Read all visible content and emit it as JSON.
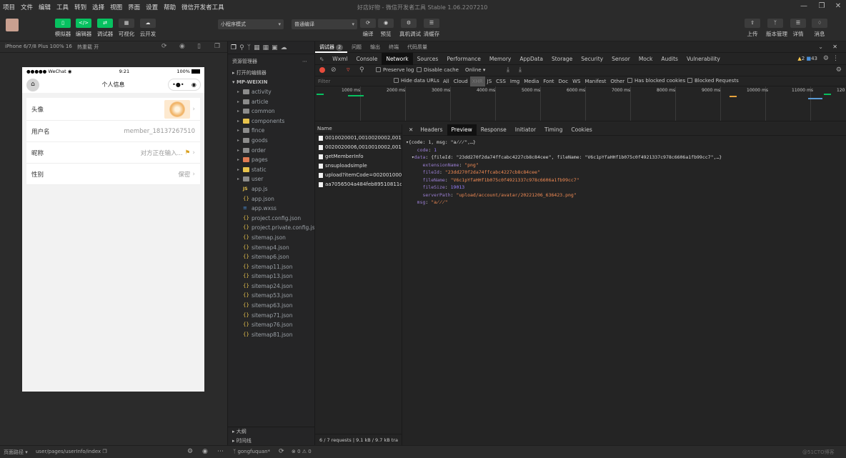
{
  "menubar": {
    "items": [
      "项目",
      "文件",
      "编辑",
      "工具",
      "转到",
      "选择",
      "视图",
      "界面",
      "设置",
      "帮助",
      "微信开发者工具"
    ],
    "title": "好店好物 - 微信开发者工具 Stable 1.06.2207210"
  },
  "toolbar": {
    "left": [
      "模拟器",
      "编辑器",
      "调试器",
      "可视化",
      "云开发"
    ],
    "compile_mode": "小程序模式",
    "compile_target": "普通编译",
    "center": [
      "编译",
      "预览",
      "真机调试",
      "清缓存"
    ],
    "right": [
      "上传",
      "版本管理",
      "详情",
      "消息"
    ]
  },
  "sim": {
    "device": "iPhone 6/7/8 Plus 100% 16",
    "hotreload": "热重载 开"
  },
  "phone": {
    "carrier": "●●●●● WeChat",
    "wifi": "◉",
    "time": "9:21",
    "battery": "100%",
    "page_title": "个人信息",
    "rows": [
      {
        "label": "头像",
        "value": ""
      },
      {
        "label": "用户名",
        "value": "member_18137267510"
      },
      {
        "label": "昵称",
        "value": "对方正在输入..."
      },
      {
        "label": "性别",
        "value": "保密"
      }
    ]
  },
  "explorer": {
    "title": "资源管理器",
    "open_editors": "打开的编辑器",
    "root": "MP-WEIXIN",
    "items": [
      {
        "name": "activity",
        "kind": "folder",
        "color": ""
      },
      {
        "name": "article",
        "kind": "folder",
        "color": ""
      },
      {
        "name": "common",
        "kind": "folder",
        "color": ""
      },
      {
        "name": "components",
        "kind": "folder",
        "color": "y"
      },
      {
        "name": "fince",
        "kind": "folder",
        "color": ""
      },
      {
        "name": "goods",
        "kind": "folder",
        "color": ""
      },
      {
        "name": "order",
        "kind": "folder",
        "color": ""
      },
      {
        "name": "pages",
        "kind": "folder",
        "color": "o"
      },
      {
        "name": "static",
        "kind": "folder",
        "color": "y"
      },
      {
        "name": "user",
        "kind": "folder",
        "color": ""
      },
      {
        "name": "app.js",
        "kind": "js"
      },
      {
        "name": "app.json",
        "kind": "json"
      },
      {
        "name": "app.wxss",
        "kind": "wxss"
      },
      {
        "name": "project.config.json",
        "kind": "json"
      },
      {
        "name": "project.private.config.js...",
        "kind": "json"
      },
      {
        "name": "sitemap.json",
        "kind": "json"
      },
      {
        "name": "sitemap4.json",
        "kind": "json"
      },
      {
        "name": "sitemap6.json",
        "kind": "json"
      },
      {
        "name": "sitemap11.json",
        "kind": "json"
      },
      {
        "name": "sitemap13.json",
        "kind": "json"
      },
      {
        "name": "sitemap24.json",
        "kind": "json"
      },
      {
        "name": "sitemap53.json",
        "kind": "json"
      },
      {
        "name": "sitemap63.json",
        "kind": "json"
      },
      {
        "name": "sitemap71.json",
        "kind": "json"
      },
      {
        "name": "sitemap76.json",
        "kind": "json"
      },
      {
        "name": "sitemap81.json",
        "kind": "json"
      }
    ],
    "outline": "大纲",
    "timeline": "时间线"
  },
  "devtools": {
    "top_tabs": [
      "调试器",
      "2",
      "问题",
      "输出",
      "终端",
      "代码质量"
    ],
    "tabs": [
      "Wxml",
      "Console",
      "Network",
      "Sources",
      "Performance",
      "Memory",
      "AppData",
      "Storage",
      "Security",
      "Sensor",
      "Mock",
      "Audits",
      "Vulnerability"
    ],
    "warn": "2",
    "info": "43",
    "preserve_log": "Preserve log",
    "disable_cache": "Disable cache",
    "online": "Online",
    "filter_placeholder": "Filter",
    "hide_data_urls": "Hide data URLs",
    "types": [
      "All",
      "Cloud",
      "XHR",
      "JS",
      "CSS",
      "Img",
      "Media",
      "Font",
      "Doc",
      "WS",
      "Manifest",
      "Other"
    ],
    "has_blocked": "Has blocked cookies",
    "blocked_requests": "Blocked Requests",
    "ticks": [
      "1000 ms",
      "2000 ms",
      "3000 ms",
      "4000 ms",
      "5000 ms",
      "6000 ms",
      "7000 ms",
      "8000 ms",
      "9000 ms",
      "10000 ms",
      "11000 ms",
      "120"
    ],
    "name_header": "Name",
    "requests": [
      "0010020001,0010020002,0010...",
      "0020020006,0010010002,0010...",
      "getMemberInfo",
      "snsuploadsimple",
      "upload?itemCode=002001000...",
      "aa7056504a484feb89510811cf..."
    ],
    "footer": "6 / 7 requests | 9.1 kB / 9.7 kB tra",
    "detail_tabs": [
      "Headers",
      "Preview",
      "Response",
      "Initiator",
      "Timing",
      "Cookies"
    ],
    "json": {
      "line1": "{code: 1, msg: \"a̸̸̸\",…}",
      "code": "1",
      "data_summary": "{fileId: \"23dd270f2da74ffcabc4227cb8c84cee\", fileName: \"V6c1pYfaHHf1b075c0f4921337c978c6606a1fb99cc7\",…}",
      "extensionName": "\"png\"",
      "fileId": "\"23dd270f2da74ffcabc4227cb8c84cee\"",
      "fileName": "\"V6c1pYfaHHf1b075c0f4921337c978c6606a1fb99cc7\"",
      "fileSize": "19013",
      "serverPath": "\"upload/account/avatar/20221206_636423.png\"",
      "msg": "\"a̸̸̸\""
    }
  },
  "statusbar": {
    "path_label": "页面路径",
    "path": "user/pages/userInfo/index",
    "branch": "gongfuquan*",
    "errors": "⊗ 0 ⚠ 0",
    "watermark": "@51CTO博客"
  }
}
